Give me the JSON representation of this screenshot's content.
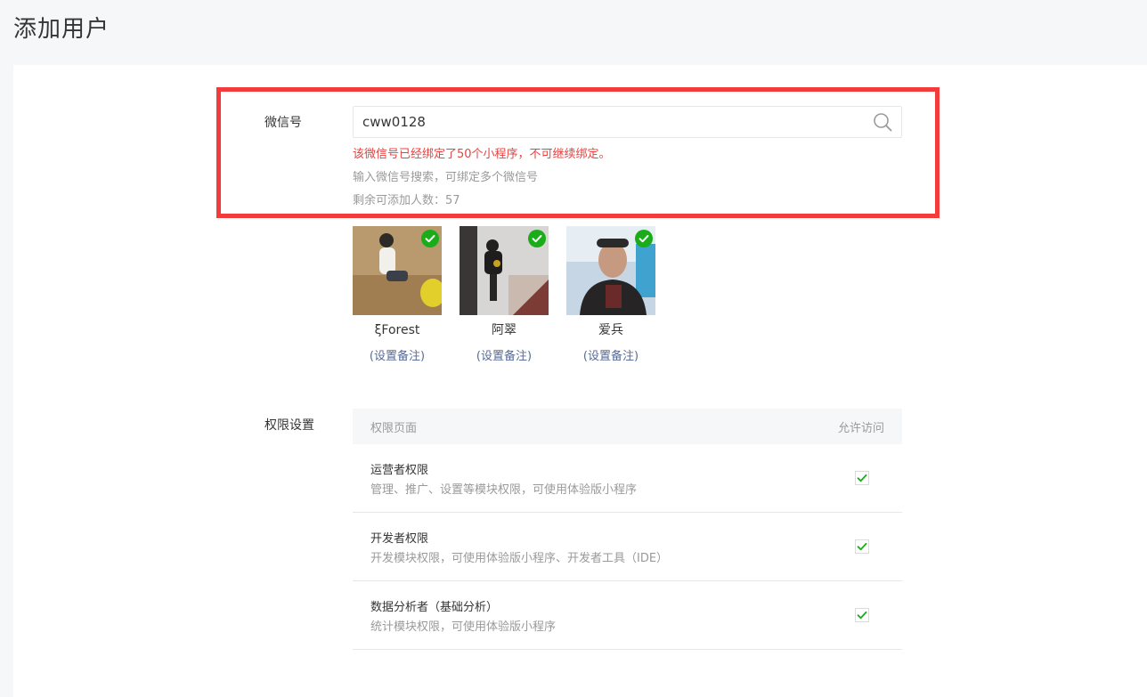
{
  "page": {
    "title": "添加用户"
  },
  "wechat": {
    "label": "微信号",
    "input_value": "cww0128",
    "error": "该微信号已经绑定了50个小程序，不可继续绑定。",
    "tip": "输入微信号搜索，可绑定多个微信号",
    "remaining": "剩余可添加人数：57"
  },
  "users": [
    {
      "name": "ξForest",
      "remark": "(设置备注)"
    },
    {
      "name": "阿翠",
      "remark": "(设置备注)"
    },
    {
      "name": "爱兵",
      "remark": "(设置备注)"
    }
  ],
  "permissions": {
    "label": "权限设置",
    "col_page": "权限页面",
    "col_access": "允许访问",
    "rows": [
      {
        "title": "运营者权限",
        "desc": "管理、推广、设置等模块权限，可使用体验版小程序",
        "checked": true
      },
      {
        "title": "开发者权限",
        "desc": "开发模块权限，可使用体验版小程序、开发者工具（IDE）",
        "checked": true
      },
      {
        "title": "数据分析者（基础分析）",
        "desc": "统计模块权限，可使用体验版小程序",
        "checked": true
      }
    ]
  },
  "colors": {
    "error": "#e64340",
    "link": "#576b95",
    "highlight": "#f33b3b",
    "check": "#1aad19"
  }
}
